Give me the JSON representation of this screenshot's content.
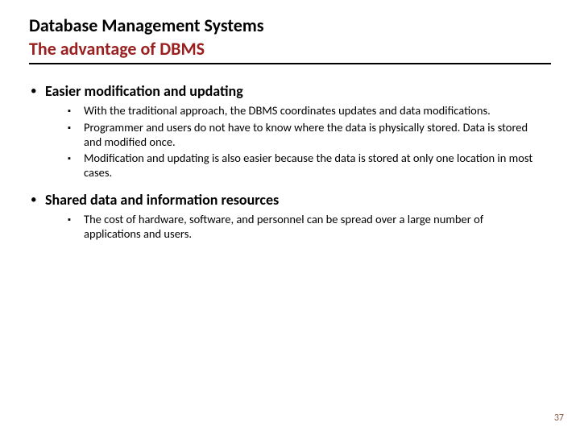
{
  "title": "Database Management Systems",
  "subtitle": "The advantage of DBMS",
  "sections": [
    {
      "heading": "Easier modification and updating",
      "items": [
        "With the traditional approach, the DBMS coordinates updates and data modifications.",
        "Programmer and users do not have to know where the data is physically stored. Data is stored and modified once.",
        "Modification and updating is also easier because the data is stored at only one location in most cases."
      ]
    },
    {
      "heading": "Shared data and information resources",
      "items": [
        "The cost of hardware, software, and personnel can be spread over a large number of applications and users."
      ]
    }
  ],
  "page_number": "37",
  "colors": {
    "subtitle": "#9a1f1f",
    "pagenum": "#8a5a44"
  }
}
